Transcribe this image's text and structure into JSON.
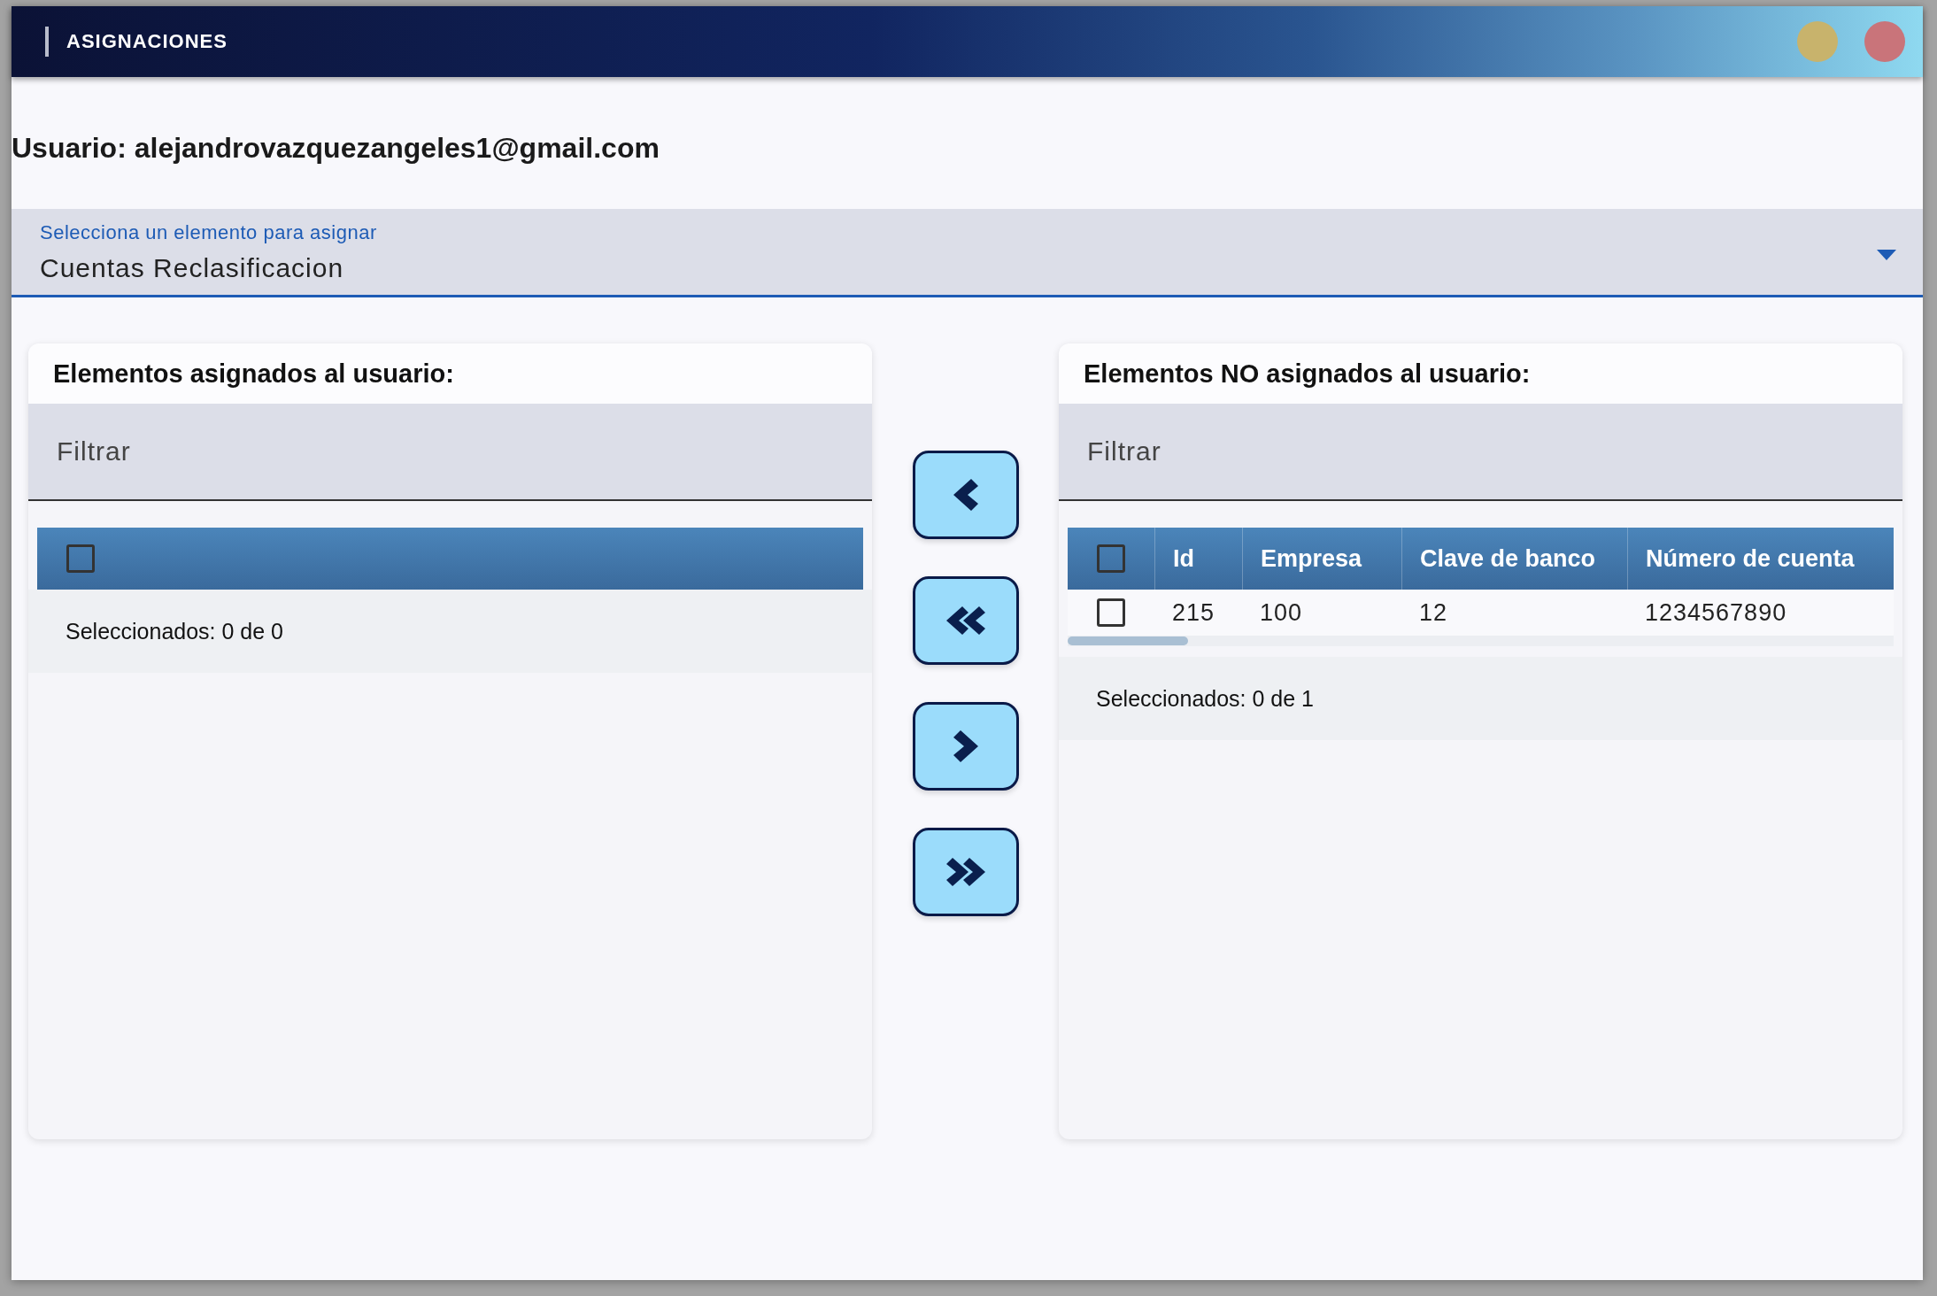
{
  "dialog": {
    "title": "ASIGNACIONES",
    "controls": [
      {
        "color": "#c8b36c"
      },
      {
        "color": "#c9747a"
      }
    ]
  },
  "user_label": "Usuario: alejandrovazquezangeles1@gmail.com",
  "select": {
    "label": "Selecciona un elemento para asignar",
    "value": "Cuentas Reclasificacion"
  },
  "assigned": {
    "title": "Elementos asignados al usuario:",
    "filter": {
      "placeholder": "Filtrar"
    },
    "table": {
      "header_checked": false
    },
    "footer": "Seleccionados: 0 de 0"
  },
  "transfer_buttons": [
    {
      "kind": "left"
    },
    {
      "kind": "double-left"
    },
    {
      "kind": "right"
    },
    {
      "kind": "double-right"
    }
  ],
  "unassigned": {
    "title": "Elementos NO asignados al usuario:",
    "filter": {
      "placeholder": "Filtrar"
    },
    "table": {
      "header_checked": false,
      "columns": [
        "Id",
        "Empresa",
        "Clave de banco",
        "Número de cuenta"
      ],
      "rows": [
        {
          "checked": false,
          "cells": [
            "215",
            "100",
            "12",
            "1234567890"
          ]
        }
      ]
    },
    "footer": "Seleccionados: 0 de 1"
  }
}
